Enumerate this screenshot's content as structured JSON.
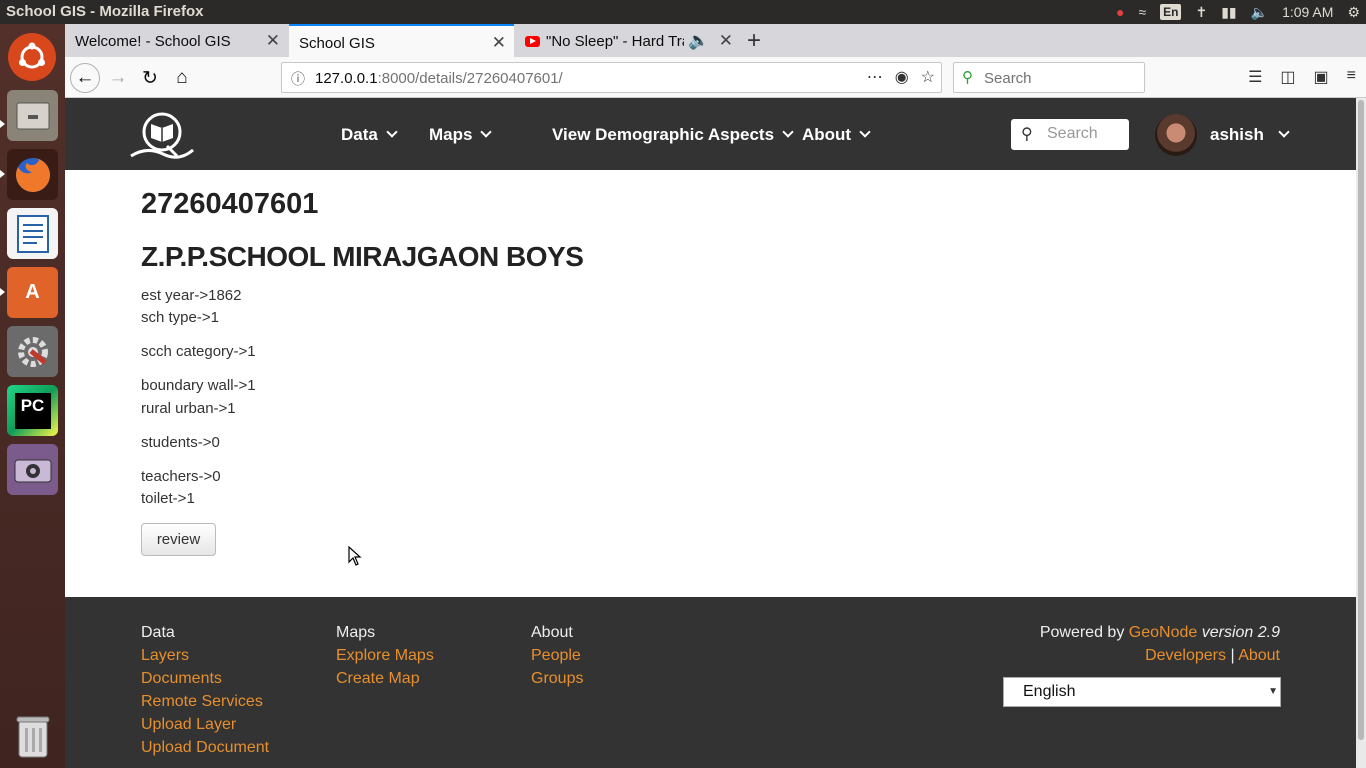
{
  "os": {
    "window_title": "School GIS - Mozilla Firefox",
    "keyboard": "En",
    "time": "1:09 AM"
  },
  "browser": {
    "tabs": [
      {
        "label": "Welcome! - School GIS",
        "active": false
      },
      {
        "label": "School GIS",
        "active": true
      },
      {
        "label": "\"No Sleep\" - Hard Trap",
        "active": false
      }
    ],
    "url_host": "127.0.0.1",
    "url_rest": ":8000/details/27260407601/",
    "search_placeholder": "Search"
  },
  "site_nav": {
    "menus": [
      "Data",
      "Maps",
      "View Demographic Aspects",
      "About"
    ],
    "search_placeholder": "Search",
    "username": "ashish"
  },
  "details": {
    "code": "27260407601",
    "name": "Z.P.P.SCHOOL MIRAJGAON BOYS",
    "fields": [
      "est year->1862",
      "sch type->1",
      "scch category->1",
      "boundary wall->1",
      "rural urban->1",
      "students->0",
      "teachers->0",
      "toilet->1"
    ],
    "review_label": "review"
  },
  "footer": {
    "data": {
      "heading": "Data",
      "links": [
        "Layers",
        "Documents",
        "Remote Services",
        "Upload Layer",
        "Upload Document"
      ]
    },
    "maps": {
      "heading": "Maps",
      "links": [
        "Explore Maps",
        "Create Map"
      ]
    },
    "about": {
      "heading": "About",
      "links": [
        "People",
        "Groups"
      ]
    },
    "powered_prefix": "Powered by",
    "powered_link": "GeoNode",
    "powered_version": "version 2.9",
    "developers": "Developers",
    "separator": "|",
    "about_link": "About",
    "language": "English"
  },
  "colors": {
    "accent": "#e78f2c",
    "nav_bg": "#333333",
    "launcher_bg": "#53302a",
    "tab_active_line": "#0a84ff"
  }
}
